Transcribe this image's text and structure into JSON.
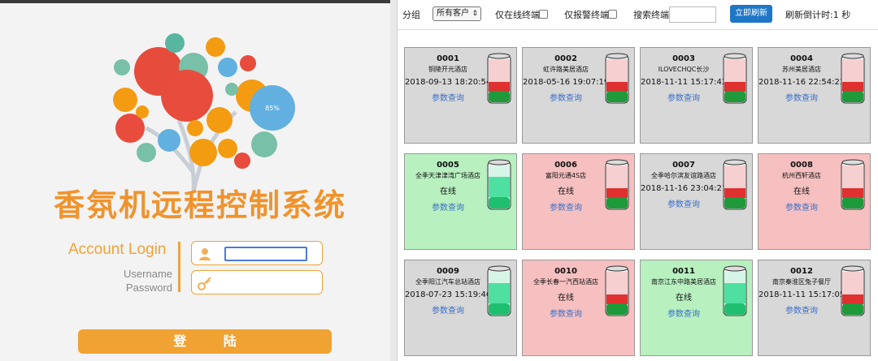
{
  "login": {
    "app_title": "香氛机远程控制系统",
    "account_title": "Account Login",
    "username_label": "Username",
    "password_label": "Password",
    "login_button": "登 陆",
    "tree_percent_label": "85%"
  },
  "toolbar": {
    "group_label": "分组",
    "group_value": "所有客户",
    "online_only_label": "仅在线终端",
    "alarm_only_label": "仅报警终端",
    "search_label": "搜索终端",
    "search_value": "",
    "refresh_button": "立即刷新",
    "countdown_label": "刷新倒计时:1 秒"
  },
  "colors": {
    "accent": "#f0a232",
    "link": "#3a6fc9",
    "button": "#1e76c7",
    "online": "#b8f0c0",
    "alarm": "#f6c0c0",
    "offline": "#d8d8d8"
  },
  "terminals": [
    {
      "id": "0001",
      "name": "铜陵开元酒店",
      "status": "2018-09-13 18:20:54",
      "link": "参数查询",
      "state": "gray",
      "liquid": "red"
    },
    {
      "id": "0002",
      "name": "虹许路美居酒店",
      "status": "2018-05-16 19:07:19",
      "link": "参数查询",
      "state": "gray",
      "liquid": "red"
    },
    {
      "id": "0003",
      "name": "ILOVECHQC长沙",
      "status": "2018-11-11 15:17:42",
      "link": "参数查询",
      "state": "gray",
      "liquid": "red"
    },
    {
      "id": "0004",
      "name": "苏州美居酒店",
      "status": "2018-11-16 22:54:23",
      "link": "参数查询",
      "state": "gray",
      "liquid": "red"
    },
    {
      "id": "0005",
      "name": "全季天津津湾广场酒店",
      "status": "在线",
      "link": "参数查询",
      "state": "green",
      "liquid": "green"
    },
    {
      "id": "0006",
      "name": "富阳元通4S店",
      "status": "在线",
      "link": "参数查询",
      "state": "red",
      "liquid": "red"
    },
    {
      "id": "0007",
      "name": "全季哈尔滨友谊路酒店",
      "status": "2018-11-16 23:04:21",
      "link": "参数查询",
      "state": "gray",
      "liquid": "red"
    },
    {
      "id": "0008",
      "name": "杭州西轩酒店",
      "status": "在线",
      "link": "参数查询",
      "state": "red",
      "liquid": "red"
    },
    {
      "id": "0009",
      "name": "全季阳江汽车总站酒店",
      "status": "2018-07-23 15:19:46",
      "link": "参数查询",
      "state": "gray",
      "liquid": "green"
    },
    {
      "id": "0010",
      "name": "全季长春一汽西站酒店",
      "status": "在线",
      "link": "参数查询",
      "state": "red",
      "liquid": "red"
    },
    {
      "id": "0011",
      "name": "南京江东中路美居酒店",
      "status": "在线",
      "link": "参数查询",
      "state": "green",
      "liquid": "green"
    },
    {
      "id": "0012",
      "name": "南京秦淮区兔子餐厅",
      "status": "2018-11-11 15:17:05",
      "link": "参数查询",
      "state": "gray",
      "liquid": "red"
    }
  ]
}
